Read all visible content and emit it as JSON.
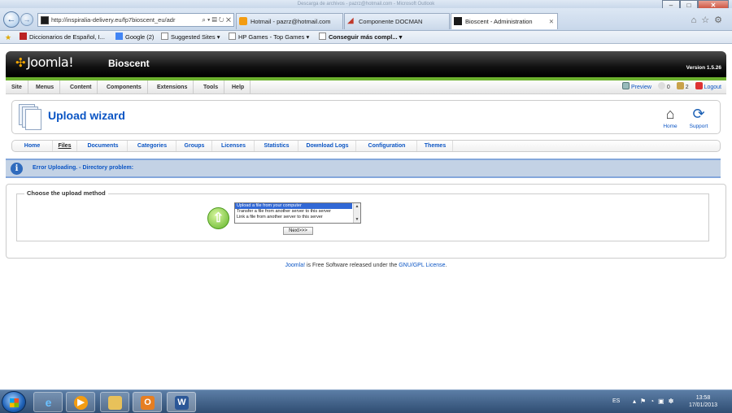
{
  "window": {
    "title": "Descarga de archivos - pazrz@hotmail.com - Microsoft Outlook"
  },
  "browser": {
    "url": "http://inspiralia-delivery.eu/fp7bioscent_eu/adr",
    "tabs": [
      {
        "label": "Hotmail - pazrz@hotmail.com",
        "active": false
      },
      {
        "label": "Componente DOCMAN",
        "active": false
      },
      {
        "label": "Bioscent - Administration",
        "active": true
      }
    ],
    "favorites": [
      {
        "label": "Diccionarios de Español, I..."
      },
      {
        "label": "Google (2)"
      },
      {
        "label": "Suggested Sites ▾"
      },
      {
        "label": "HP Games - Top Games ▾"
      },
      {
        "label": "Conseguir más compl... ▾"
      }
    ]
  },
  "joomla": {
    "logo_text": "Joomla!",
    "site_name": "Bioscent",
    "version": "Version 1.5.26",
    "menu": [
      "Site",
      "Menus",
      "Content",
      "Components",
      "Extensions",
      "Tools",
      "Help"
    ],
    "status": {
      "preview": "Preview",
      "messages": "0",
      "users": "2",
      "logout": "Logout"
    }
  },
  "toolbar": {
    "title": "Upload wizard",
    "home_label": "Home",
    "support_label": "Support"
  },
  "submenu": [
    "Home",
    "Files",
    "Documents",
    "Categories",
    "Groups",
    "Licenses",
    "Statistics",
    "Download Logs",
    "Configuration",
    "Themes"
  ],
  "submenu_current": "Files",
  "message": "Error Uploading. - Directory problem:",
  "upload": {
    "legend": "Choose the upload method",
    "options": [
      "Upload a file from your computer",
      "Transfer a file from another server to this server",
      "Link a file from another server to this server"
    ],
    "selected_option": "Upload a file from your computer",
    "next_label": "Next>>>"
  },
  "footer": {
    "joomla_link": "Joomla!",
    "text": " is Free Software released under the ",
    "license_link": "GNU/GPL License",
    "end": "."
  },
  "taskbar": {
    "language": "ES",
    "time": "13:58",
    "date": "17/01/2013"
  }
}
